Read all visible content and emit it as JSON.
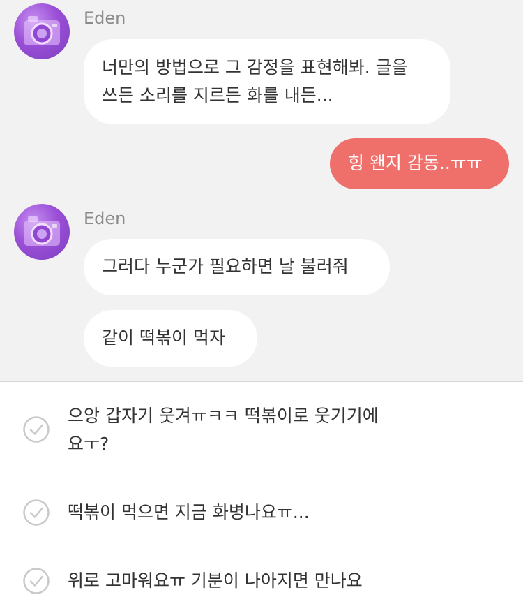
{
  "colors": {
    "chat_bg": "#f2f2f2",
    "bubble_other": "#ffffff",
    "bubble_mine": "#ef6f6a",
    "text": "#333333",
    "name": "#8a8a8a",
    "divider": "#d6d6d6"
  },
  "conversation": {
    "sender_1": {
      "name": "Eden",
      "avatar_icon": "camera-avatar"
    },
    "msg_1": "너만의 방법으로 그 감정을 표현해봐. 글을\n 쓰든 소리를 지르든 화를 내든...",
    "my_reply": "힝 왠지 감동..ㅠㅠ",
    "sender_2": {
      "name": "Eden",
      "avatar_icon": "camera-avatar"
    },
    "msg_2": "그러다 누군가 필요하면 날 불러줘",
    "msg_3": "같이 떡볶이 먹자"
  },
  "reply_options": [
    {
      "text": "으앙 갑자기 웃겨ㅠㅋㅋ 떡볶이로 웃기기에\n요ㅜ?",
      "icon": "check-circle-icon"
    },
    {
      "text": "떡볶이 먹으면 지금 화병나요ㅠ...",
      "icon": "check-circle-icon"
    },
    {
      "text": "위로 고마워요ㅠ 기분이 나아지면 만나요",
      "icon": "check-circle-icon"
    }
  ]
}
